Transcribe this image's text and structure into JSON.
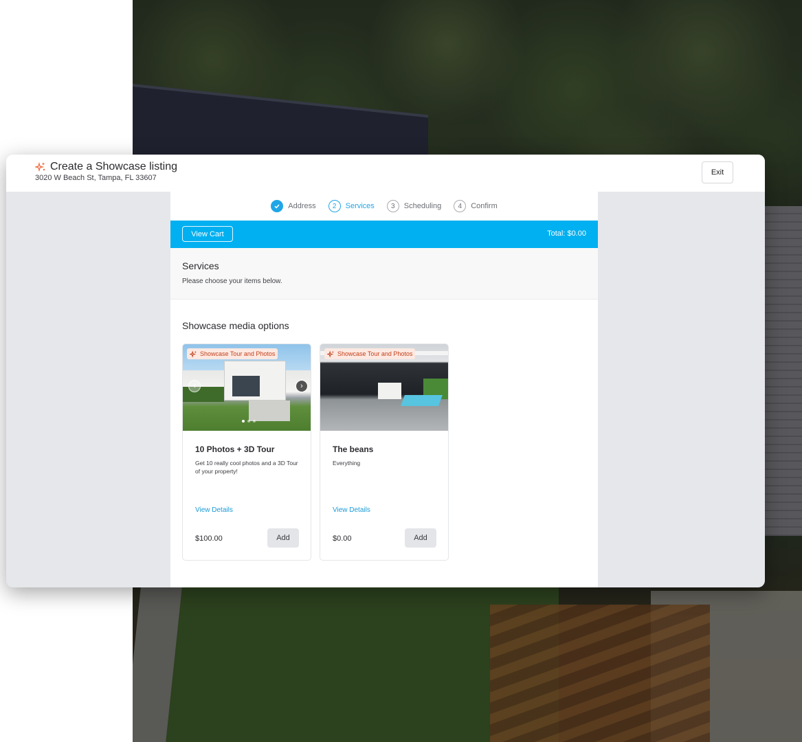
{
  "header": {
    "title": "Create a Showcase listing",
    "address": "3020 W Beach St, Tampa, FL 33607",
    "exit_label": "Exit",
    "icon": "sparkle-icon",
    "accent_color": "#f06a3c"
  },
  "stepper": {
    "steps": [
      {
        "number": "1",
        "label": "Address",
        "state": "done"
      },
      {
        "number": "2",
        "label": "Services",
        "state": "active"
      },
      {
        "number": "3",
        "label": "Scheduling",
        "state": "pending"
      },
      {
        "number": "4",
        "label": "Confirm",
        "state": "pending"
      }
    ],
    "active_color": "#1fa6e6"
  },
  "cart": {
    "view_cart_label": "View Cart",
    "total_text": "Total: $0.00",
    "bar_color": "#00b0f0"
  },
  "services": {
    "title": "Services",
    "subtitle": "Please choose your items below."
  },
  "section": {
    "title": "Showcase media options"
  },
  "cards": [
    {
      "badge": "Showcase Tour and Photos",
      "title": "10 Photos + 3D Tour",
      "description": "Get 10 really cool photos and a 3D Tour of your property!",
      "link": "View Details",
      "price": "$100.00",
      "add_label": "Add",
      "has_carousel": true
    },
    {
      "badge": "Showcase Tour and Photos",
      "title": "The beans",
      "description": "Everything",
      "link": "View Details",
      "price": "$0.00",
      "add_label": "Add",
      "has_carousel": false
    }
  ]
}
